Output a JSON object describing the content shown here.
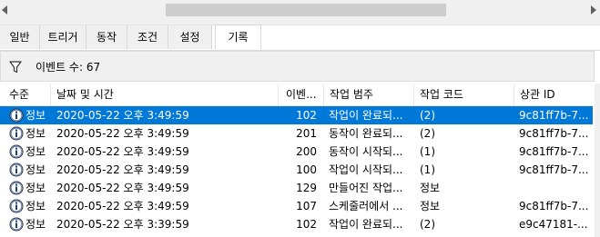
{
  "tabs": [
    {
      "label": "일반"
    },
    {
      "label": "트리거"
    },
    {
      "label": "동작"
    },
    {
      "label": "조건"
    },
    {
      "label": "설정"
    },
    {
      "label": "기록"
    }
  ],
  "infobar": {
    "event_count": "이벤트 수: 67"
  },
  "columns": [
    "수준",
    "날짜 및 시간",
    "이벤...",
    "작업 범주",
    "작업 코드",
    "상관 ID"
  ],
  "rows": [
    {
      "level": "정보",
      "datetime": "2020-05-22 오후 3:49:59",
      "id": "102",
      "category": "작업이 완료되...",
      "opcode": "(2)",
      "correlation": "9c81ff7b-7..."
    },
    {
      "level": "정보",
      "datetime": "2020-05-22 오후 3:49:59",
      "id": "201",
      "category": "동작이 완료되...",
      "opcode": "(2)",
      "correlation": "9c81ff7b-7..."
    },
    {
      "level": "정보",
      "datetime": "2020-05-22 오후 3:49:59",
      "id": "200",
      "category": "동작이 시작되...",
      "opcode": "(1)",
      "correlation": "9c81ff7b-7..."
    },
    {
      "level": "정보",
      "datetime": "2020-05-22 오후 3:49:59",
      "id": "100",
      "category": "작업이 시작되...",
      "opcode": "(1)",
      "correlation": "9c81ff7b-7..."
    },
    {
      "level": "정보",
      "datetime": "2020-05-22 오후 3:49:59",
      "id": "129",
      "category": "만들어진 작업...",
      "opcode": "정보",
      "correlation": ""
    },
    {
      "level": "정보",
      "datetime": "2020-05-22 오후 3:49:59",
      "id": "107",
      "category": "스케줄러에서 ...",
      "opcode": "정보",
      "correlation": "9c81ff7b-7..."
    },
    {
      "level": "정보",
      "datetime": "2020-05-22 오후 3:39:59",
      "id": "102",
      "category": "작업이 완료되...",
      "opcode": "(2)",
      "correlation": "e9c47181-..."
    }
  ],
  "selected_row": 0,
  "colors": {
    "selection": "#0078d7",
    "icon_blue": "#1a5fb4"
  }
}
